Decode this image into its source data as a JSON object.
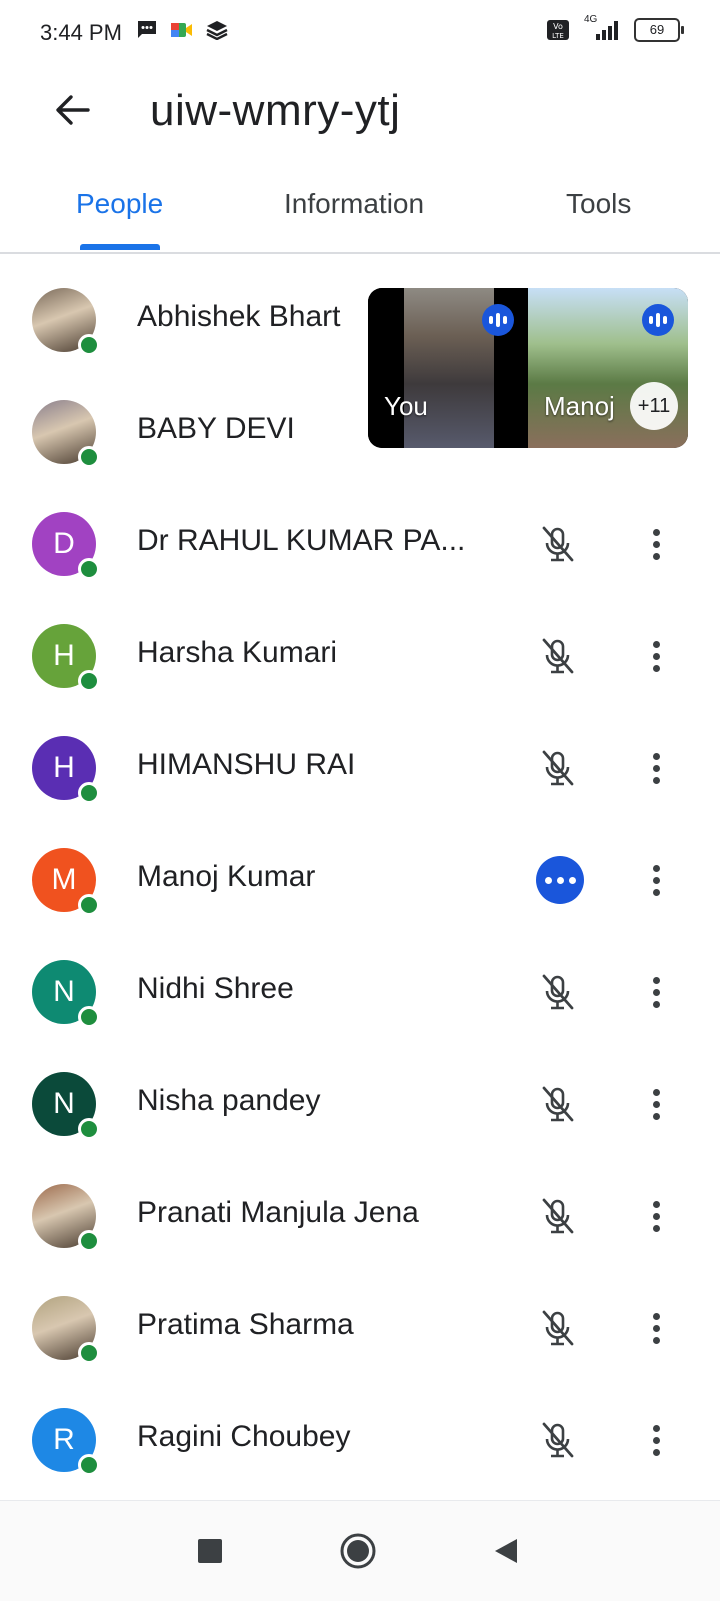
{
  "status_bar": {
    "time": "3:44 PM",
    "network": "4G",
    "battery": "69",
    "icons_left": [
      "message-icon",
      "meet-icon",
      "layers-icon"
    ],
    "icons_right": [
      "volte-icon",
      "signal-icon",
      "battery-icon"
    ]
  },
  "header": {
    "meeting_code": "uiw-wmry-ytj",
    "back_icon": "arrow-back-icon"
  },
  "tabs": [
    {
      "label": "People",
      "active": true
    },
    {
      "label": "Information",
      "active": false
    },
    {
      "label": "Tools",
      "active": false
    }
  ],
  "pip": {
    "tiles": [
      {
        "label": "You"
      },
      {
        "label": "Manoj"
      }
    ],
    "more_count": "+11"
  },
  "participants": [
    {
      "name": "Abhishek Bhart",
      "initial": "",
      "photo": true,
      "color": "#7a6a5a",
      "mic": "hidden"
    },
    {
      "name": "BABY DEVI",
      "initial": "",
      "photo": true,
      "color": "#8a7f8c",
      "mic": "hidden"
    },
    {
      "name": "Dr RAHUL KUMAR PA...",
      "initial": "D",
      "photo": false,
      "color": "#a142c2",
      "mic": "muted"
    },
    {
      "name": "Harsha Kumari",
      "initial": "H",
      "photo": false,
      "color": "#66a33a",
      "mic": "muted"
    },
    {
      "name": "HIMANSHU RAI",
      "initial": "H",
      "photo": false,
      "color": "#5a2eb3",
      "mic": "muted"
    },
    {
      "name": "Manoj Kumar",
      "initial": "M",
      "photo": false,
      "color": "#f0521f",
      "mic": "speaking"
    },
    {
      "name": "Nidhi Shree",
      "initial": "N",
      "photo": false,
      "color": "#0e8a72",
      "mic": "muted"
    },
    {
      "name": "Nisha pandey",
      "initial": "N",
      "photo": false,
      "color": "#0b4a3a",
      "mic": "muted"
    },
    {
      "name": "Pranati Manjula Jena",
      "initial": "",
      "photo": true,
      "color": "#9c6a4c",
      "mic": "muted"
    },
    {
      "name": "Pratima Sharma",
      "initial": "",
      "photo": true,
      "color": "#b1a37f",
      "mic": "muted"
    },
    {
      "name": "Ragini Choubey",
      "initial": "R",
      "photo": false,
      "color": "#1e88e5",
      "mic": "muted"
    }
  ],
  "nav_bar": {
    "icons": [
      "recents-square-icon",
      "home-circle-icon",
      "back-triangle-icon"
    ]
  }
}
